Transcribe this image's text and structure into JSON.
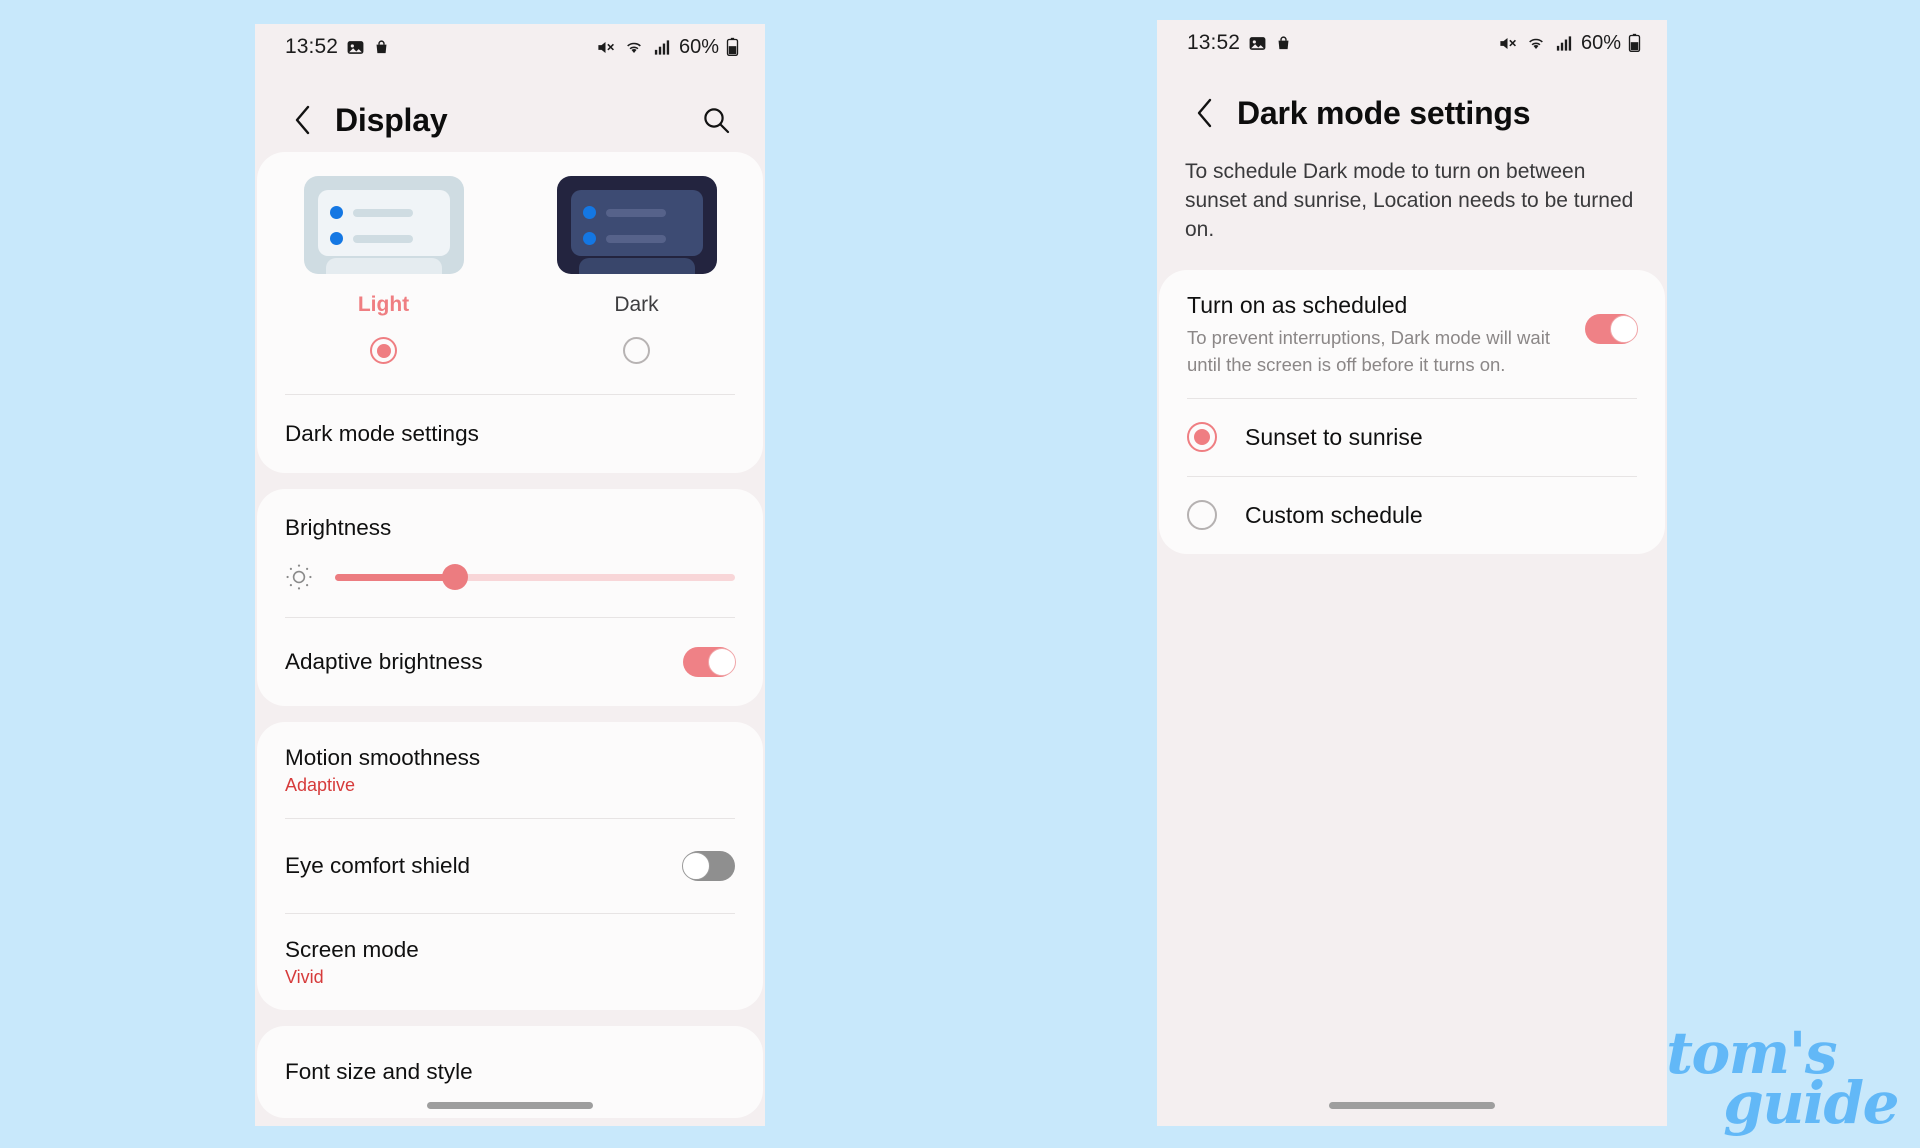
{
  "page": {
    "background_color": "#c8e8fb",
    "watermark": {
      "line1": "tom's",
      "line2": "guide",
      "color": "#62b8f7"
    }
  },
  "status_bar": {
    "time": "13:52",
    "battery_percent": "60%",
    "icons": [
      "image-icon",
      "shopping-bag-icon",
      "mute-icon",
      "wifi-icon",
      "signal-icon",
      "battery-icon"
    ]
  },
  "left_phone": {
    "header": {
      "title": "Display",
      "back": "back-icon",
      "search": "search-icon"
    },
    "theme": {
      "options": [
        {
          "name": "Light",
          "selected": true
        },
        {
          "name": "Dark",
          "selected": false
        }
      ],
      "selected_color": "#ef7e82"
    },
    "dark_mode_settings_label": "Dark mode settings",
    "brightness": {
      "title": "Brightness",
      "icon": "sun-icon",
      "value_percent": 30
    },
    "adaptive_brightness": {
      "label": "Adaptive brightness",
      "enabled": true
    },
    "motion_smoothness": {
      "label": "Motion smoothness",
      "value": "Adaptive"
    },
    "eye_comfort_shield": {
      "label": "Eye comfort shield",
      "enabled": false
    },
    "screen_mode": {
      "label": "Screen mode",
      "value": "Vivid"
    },
    "font_size_and_style": {
      "label": "Font size and style"
    }
  },
  "right_phone": {
    "header": {
      "title": "Dark mode settings",
      "back": "back-icon"
    },
    "description": "To schedule Dark mode to turn on between sunset and sunrise, Location needs to be turned on.",
    "turn_on_as_scheduled": {
      "title": "Turn on as scheduled",
      "subtitle": "To prevent interruptions, Dark mode will wait until the screen is off before it turns on.",
      "enabled": true
    },
    "schedule_options": [
      {
        "label": "Sunset to sunrise",
        "selected": true
      },
      {
        "label": "Custom schedule",
        "selected": false
      }
    ]
  }
}
